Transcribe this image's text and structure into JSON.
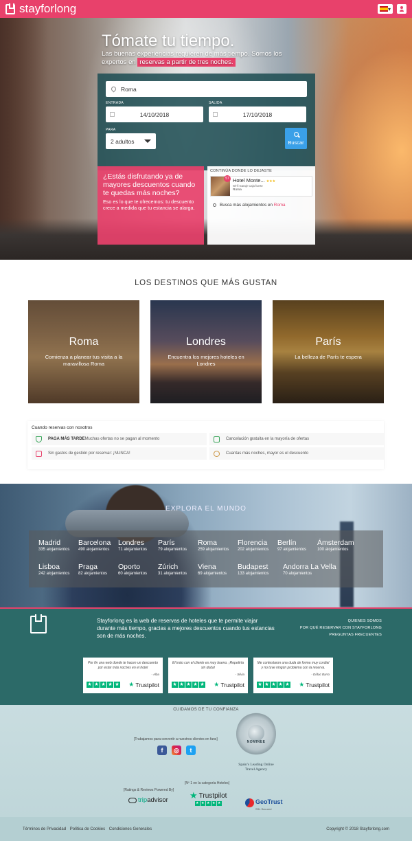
{
  "brand": {
    "name": "stayforlong"
  },
  "hero": {
    "title": "Tómate tu tiempo.",
    "subtitle": "Las buenas experiencias requieren de más tiempo. Somos los expertos en",
    "subtitle_highlight": "reservas a partir de tres noches."
  },
  "search": {
    "destination": "Roma",
    "checkin_label": "ENTRADA",
    "checkin": "14/10/2018",
    "checkout_label": "SALIDA",
    "checkout": "17/10/2018",
    "guests_label": "PARA",
    "guests": "2 adultos",
    "button": "Buscar"
  },
  "promo": {
    "title": "¿Estás disfrutando ya de mayores descuentos cuando te quedas más noches?",
    "text": "Eso es lo que te ofrecemos: tu descuento crece a medida que tu estancia se alarga."
  },
  "continue": {
    "title": "CONTINÚA DONDE LO DEJASTE",
    "hotel_name": "Hotel Monte...",
    "hotel_badge": "57",
    "hotel_stars": "★★★",
    "hotel_meta": "Wi-fi   Garaje   Caja fuerte",
    "hotel_city": "Roma",
    "more_prefix": "Busca más alojamientos en",
    "more_city": "Roma"
  },
  "destinations": {
    "title": "LOS DESTINOS QUE MÁS GUSTAN",
    "cards": [
      {
        "name": "Roma",
        "desc": "Comienza a planear tus visita a la maravillosa Roma"
      },
      {
        "name": "Londres",
        "desc": "Encuentra los mejores hoteles en Londres"
      },
      {
        "name": "París",
        "desc": "La belleza de París te espera"
      }
    ]
  },
  "benefits": {
    "title": "Cuando reservas con nosotros",
    "items": [
      {
        "bold": "PAGA MÁS TARDE",
        "text": "Muchas ofertas no se pagan al momento"
      },
      {
        "bold": "",
        "text": "Cancelación gratuita en la mayoría de ofertas"
      },
      {
        "bold": "",
        "text": "Sin gastos de gestión por reservar: ¡NUNCA!"
      },
      {
        "bold": "",
        "text": "Cuantas más noches, mayor es el descuento"
      }
    ]
  },
  "explore": {
    "title": "EXPLORA EL MUNDO",
    "cities": [
      {
        "name": "Madrid",
        "count": "335 alojamientos"
      },
      {
        "name": "Barcelona",
        "count": "490 alojamientos"
      },
      {
        "name": "Londres",
        "count": "71 alojamientos"
      },
      {
        "name": "París",
        "count": "79 alojamientos"
      },
      {
        "name": "Roma",
        "count": "259 alojamientos"
      },
      {
        "name": "Florencia",
        "count": "202 alojamientos"
      },
      {
        "name": "Berlín",
        "count": "97 alojamientos"
      },
      {
        "name": "Ámsterdam",
        "count": "100 alojamientos"
      },
      {
        "name": "Lisboa",
        "count": "242 alojamientos"
      },
      {
        "name": "Praga",
        "count": "82 alojamientos"
      },
      {
        "name": "Oporto",
        "count": "60 alojamientos"
      },
      {
        "name": "Zúrich",
        "count": "31 alojamientos"
      },
      {
        "name": "Viena",
        "count": "69 alojamientos"
      },
      {
        "name": "Budapest",
        "count": "133 alojamientos"
      },
      {
        "name": "Andorra La Vella",
        "count": "70 alojamientos"
      }
    ]
  },
  "footer": {
    "about": "Stayforlong es la web de reservas de hoteles que te permite viajar durante más tiempo, gracias a mejores descuentos cuando tus estancias son de más noches.",
    "links": [
      "QUIENES SOMOS",
      "POR QUÉ RESERVAR CON STAYFORLONG",
      "PREGUNTAS FRECUENTES"
    ],
    "reviews": [
      {
        "quote": "Por fin una web donde te hacen un descuento por estar más noches en el hotel",
        "author": "- Alba"
      },
      {
        "quote": "El trato con el cliente es muy bueno. ¡Repetiría sin duda!",
        "author": "- Silvia"
      },
      {
        "quote": "Me contestaron una duda de forma muy cordial y no tuve ningún problema con la reserva.",
        "author": "- Dídac Barro"
      }
    ],
    "trustpilot": "Trustpilot"
  },
  "trust": {
    "title": "CUIDAMOS DE TU CONFIANZA",
    "note": "[Trabajamos para convertir a nuestros clientes en fans]",
    "nominee_text": "NOMINEE",
    "nominee_caption": "Spain's Leading Online Travel Agency",
    "tp_caption": "[Nº 1 en la categoría Hoteles]",
    "ratings_caption": "[Ratings & Reviews Powered By]",
    "tripadvisor_a": "trip",
    "tripadvisor_b": "advisor",
    "trustpilot": "Trustpilot",
    "geotrust": "GeoTrust",
    "geotrust_sub": "SSL Secured"
  },
  "bottom": {
    "links": [
      "Términos de Privacidad",
      "Política de Cookies",
      "Condiciones Generales"
    ],
    "copyright": "Copyright © 2018 Stayforlong.com"
  }
}
